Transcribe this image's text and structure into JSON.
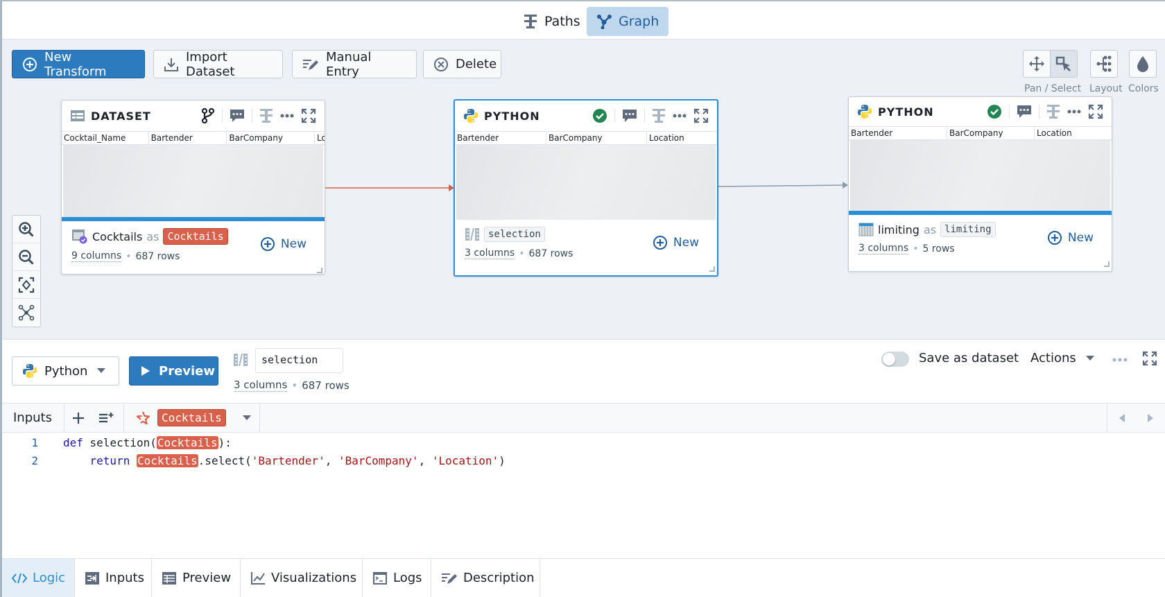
{
  "view_toggle": {
    "paths_label": "Paths",
    "graph_label": "Graph",
    "active": "Graph"
  },
  "toolbar": {
    "new_transform": "New Transform",
    "import_dataset": "Import Dataset",
    "manual_entry": "Manual Entry",
    "delete": "Delete",
    "pan_select_label": "Pan / Select",
    "layout_label": "Layout",
    "colors_label": "Colors",
    "active_mode": "select"
  },
  "nodes": [
    {
      "type": "DATASET",
      "columns": [
        "Cocktail_Name",
        "Bartender",
        "BarCompany",
        "Lo"
      ],
      "name": "Cocktails",
      "as_label": "as",
      "alias": "Cocktails",
      "columns_count": "9 columns",
      "rows_count": "687 rows",
      "new_label": "New"
    },
    {
      "type": "PYTHON",
      "status": "success",
      "columns": [
        "Bartender",
        "BarCompany",
        "Location"
      ],
      "name": "selection",
      "columns_count": "3 columns",
      "rows_count": "687 rows",
      "new_label": "New",
      "selected": true
    },
    {
      "type": "PYTHON",
      "status": "success",
      "columns": [
        "Bartender",
        "BarCompany",
        "Location"
      ],
      "name": "limiting",
      "as_label": "as",
      "alias": "limiting",
      "columns_count": "3 columns",
      "rows_count": "5 rows",
      "new_label": "New"
    }
  ],
  "editor": {
    "language": "Python",
    "preview_label": "Preview",
    "output_name": "selection",
    "columns_count": "3 columns",
    "rows_count": "687 rows",
    "save_as_dataset_label": "Save as dataset",
    "save_as_dataset": false,
    "actions_label": "Actions",
    "inputs_label": "Inputs",
    "input_alias": "Cocktails",
    "code": [
      {
        "num": "1",
        "parts": [
          [
            "kw",
            "def"
          ],
          [
            "txt",
            " selection("
          ],
          [
            "hl",
            "Cocktails"
          ],
          [
            "txt",
            "):"
          ]
        ]
      },
      {
        "num": "2",
        "parts": [
          [
            "txt",
            "    "
          ],
          [
            "kw",
            "return"
          ],
          [
            "txt",
            " "
          ],
          [
            "hl",
            "Cocktails"
          ],
          [
            "txt",
            ".select("
          ],
          [
            "str",
            "'Bartender'"
          ],
          [
            "txt",
            ", "
          ],
          [
            "str",
            "'BarCompany'"
          ],
          [
            "txt",
            ", "
          ],
          [
            "str",
            "'Location'"
          ],
          [
            "txt",
            ")"
          ]
        ]
      }
    ]
  },
  "bottom_tabs": [
    {
      "label": "Logic",
      "active": true
    },
    {
      "label": "Inputs"
    },
    {
      "label": "Preview"
    },
    {
      "label": "Visualizations"
    },
    {
      "label": "Logs"
    },
    {
      "label": "Description"
    }
  ],
  "colors": {
    "primary": "#2d7bbf",
    "selection": "#2b8fd6",
    "alias_tag": "#d9604a",
    "success": "#238551",
    "edge_active": "#d9604a",
    "edge_default": "#8a9ba8"
  }
}
